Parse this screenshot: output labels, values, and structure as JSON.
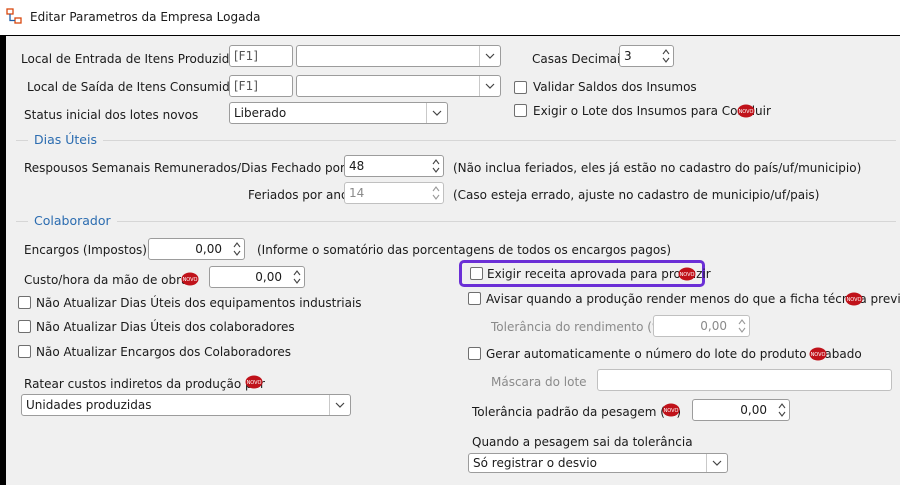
{
  "window": {
    "title": "Editar Parametros da Empresa Logada"
  },
  "colors": {
    "accent": "#2b6cb0",
    "highlight": "#6b2fd6",
    "badge": "#c0121a"
  },
  "badge_text": "NOVO",
  "fields": {
    "local_entrada": {
      "label": "Local de Entrada de Itens Produzidos",
      "code": "[F1]",
      "value": ""
    },
    "local_saida": {
      "label": "Local de Saída de Itens Consumidos",
      "code": "[F1]",
      "value": ""
    },
    "status_lotes": {
      "label": "Status inicial dos lotes novos",
      "value": "Liberado"
    },
    "casas_decimais": {
      "label": "Casas Decimais",
      "value": "3"
    },
    "validar_saldos": {
      "label": "Validar Saldos dos Insumos",
      "checked": false
    },
    "exigir_lote": {
      "label": "Exigir o Lote dos Insumos para Concluir",
      "checked": false
    }
  },
  "dias_uteis": {
    "title": "Dias Úteis",
    "repousos": {
      "label": "Respousos Semanais Remunerados/Dias Fechado por ano",
      "value": "48",
      "hint": "(Não inclua feriados, eles já estão no cadastro do país/uf/municipio)"
    },
    "feriados": {
      "label": "Feriados por ano",
      "value": "14",
      "hint": "(Caso esteja errado, ajuste no cadastro de municipio/uf/pais)"
    }
  },
  "colaborador": {
    "title": "Colaborador",
    "encargos": {
      "label": "Encargos (Impostos)",
      "value": "0,00",
      "hint": "(Informe o somatório das porcentagens de todos os encargos pagos)"
    },
    "custo_hora": {
      "label": "Custo/hora da mão de obra:",
      "value": "0,00"
    },
    "nao_atualizar_equip": {
      "label": "Não Atualizar Dias Úteis dos equipamentos industriais",
      "checked": false
    },
    "nao_atualizar_colab": {
      "label": "Não Atualizar Dias Úteis dos colaboradores",
      "checked": false
    },
    "nao_atualizar_encargos": {
      "label": "Não Atualizar Encargos dos Colaboradores",
      "checked": false
    },
    "ratear": {
      "label": "Ratear custos indiretos da produção por",
      "value": "Unidades produzidas"
    },
    "exigir_receita": {
      "label": "Exigir receita aprovada para produzir",
      "checked": false
    },
    "avisar_producao": {
      "label": "Avisar quando a produção render menos do que a ficha técnica previa",
      "checked": false
    },
    "tolerancia_rend": {
      "label": "Tolerância do rendimento (%)",
      "value": "0,00"
    },
    "gerar_lote": {
      "label": "Gerar automaticamente o número do lote do produto acabado",
      "checked": false
    },
    "mascara_lote": {
      "label": "Máscara do lote",
      "value": ""
    },
    "tolerancia_pesagem": {
      "label": "Tolerância padrão da pesagem (%)",
      "value": "0,00"
    },
    "quando_pesagem": {
      "label": "Quando a pesagem sai da tolerância",
      "value": "Só registrar o desvio"
    }
  }
}
